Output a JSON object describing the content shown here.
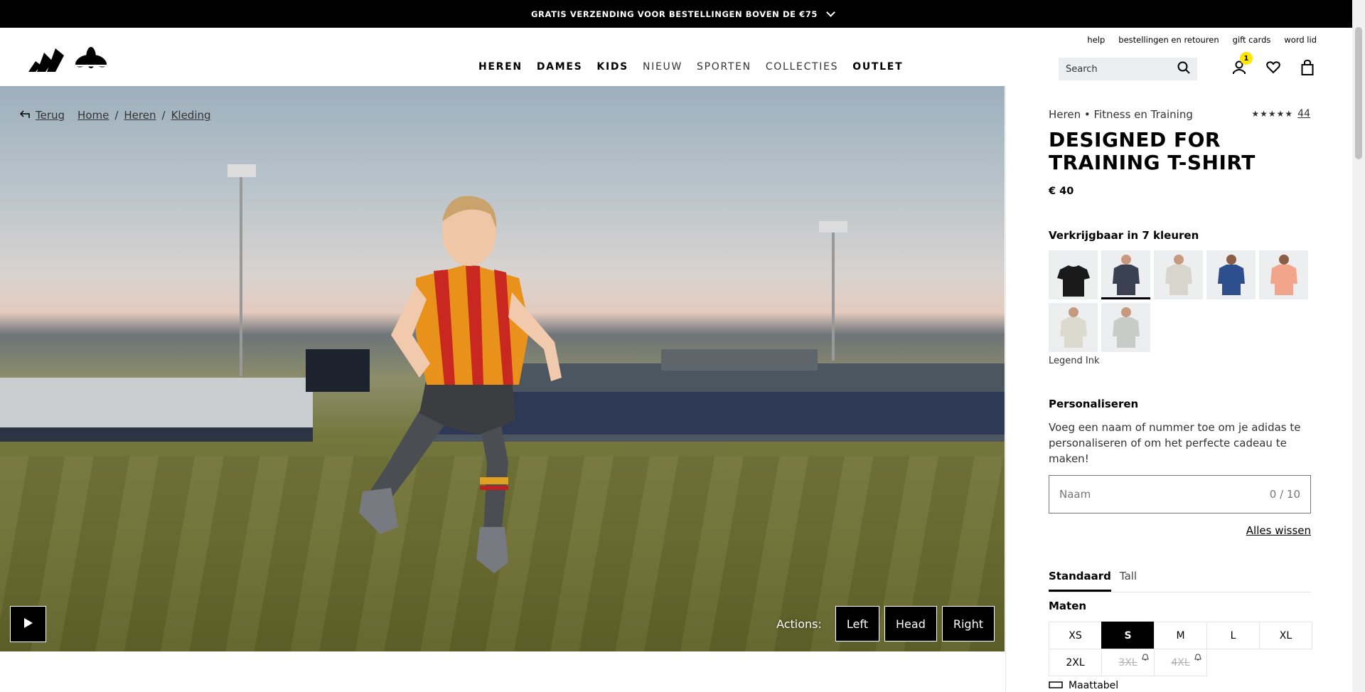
{
  "promo": {
    "text": "GRATIS VERZENDING VOOR BESTELLINGEN BOVEN DE €75"
  },
  "util_links": [
    "help",
    "bestellingen en retouren",
    "gift cards",
    "word lid"
  ],
  "nav": [
    "HEREN",
    "DAMES",
    "KIDS",
    "NIEUW",
    "SPORTEN",
    "COLLECTIES",
    "OUTLET"
  ],
  "search": {
    "placeholder": "Search"
  },
  "account": {
    "badge": "1"
  },
  "breadcrumb": {
    "back": "Terug",
    "items": [
      "Home",
      "Heren",
      "Kleding"
    ],
    "sep": "/"
  },
  "media": {
    "actions_label": "Actions:",
    "actions": [
      "Left",
      "Head",
      "Right"
    ]
  },
  "product": {
    "category": "Heren • Fitness en Training",
    "rating_stars": "★★★★★",
    "review_count": "44",
    "title": "DESIGNED FOR TRAINING T-SHIRT",
    "price": "€ 40",
    "colors_heading": "Verkrijgbaar in 7 kleuren",
    "selected_color": "Legend Ink",
    "personalize_heading": "Personaliseren",
    "personalize_desc": "Voeg een naam of nummer toe om je adidas te personaliseren of om het perfecte cadeau te maken!",
    "name_placeholder": "Naam",
    "name_counter": "0 / 10",
    "clear_all": "Alles wissen",
    "fit_tabs": [
      "Standaard",
      "Tall"
    ],
    "sizes_heading": "Maten",
    "sizes": [
      "XS",
      "S",
      "M",
      "L",
      "XL",
      "2XL",
      "3XL",
      "4XL"
    ],
    "size_guide": "Maattabel"
  },
  "colors": {
    "swatches": [
      "#1a1a1a",
      "#3a4150",
      "#d8d6cc",
      "#2d4f8e",
      "#f2a58a",
      "#dcd9cf",
      "#c8ccc8"
    ],
    "accent_badge": "#ffe700"
  }
}
